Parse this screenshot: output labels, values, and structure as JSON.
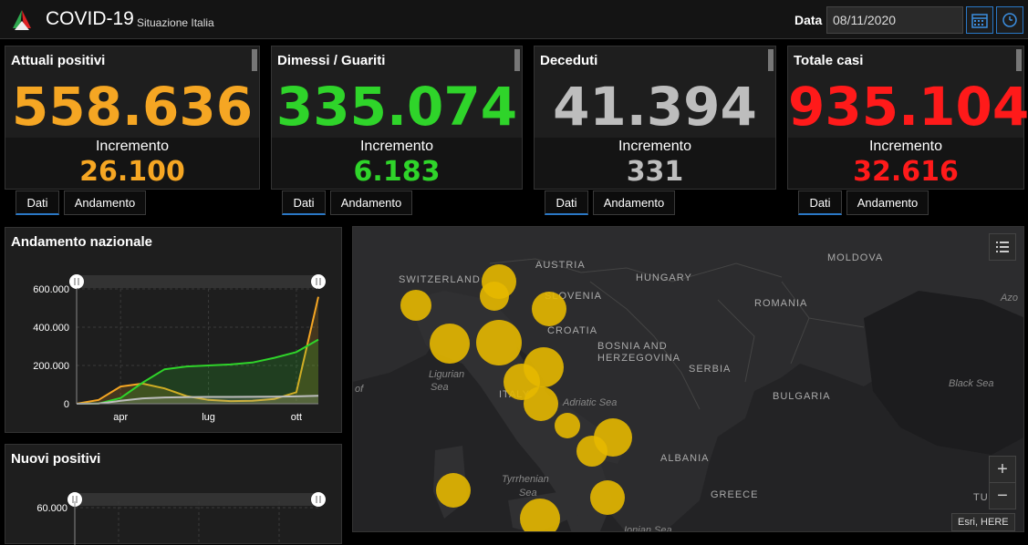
{
  "header": {
    "title": "COVID-19",
    "subtitle": "Situazione Italia",
    "date_label": "Data",
    "date_value": "08/11/2020"
  },
  "cards": [
    {
      "title": "Attuali positivi",
      "value": "558.636",
      "inc_label": "Incremento",
      "inc_value": "26.100",
      "color": "#f5a623"
    },
    {
      "title": "Dimessi / Guariti",
      "value": "335.074",
      "inc_label": "Incremento",
      "inc_value": "6.183",
      "color": "#2fd42a"
    },
    {
      "title": "Deceduti",
      "value": "41.394",
      "inc_label": "Incremento",
      "inc_value": "331",
      "color": "#bdbdbd"
    },
    {
      "title": "Totale casi",
      "value": "935.104",
      "inc_label": "Incremento",
      "inc_value": "32.616",
      "color": "#ff1a1a"
    }
  ],
  "tabs": {
    "dati": "Dati",
    "andamento": "Andamento"
  },
  "panels": {
    "andamento_title": "Andamento nazionale",
    "nuovi_title": "Nuovi positivi"
  },
  "chart_data": [
    {
      "type": "line",
      "title": "Andamento nazionale",
      "y_ticks": [
        "600.000",
        "400.000",
        "200.000",
        "0"
      ],
      "ylim": [
        0,
        600000
      ],
      "x_ticks": [
        "apr",
        "lug",
        "ott"
      ],
      "series": [
        {
          "color": "#f5a623",
          "values": [
            0,
            20000,
            90000,
            105000,
            80000,
            40000,
            20000,
            14000,
            15000,
            25000,
            60000,
            558636
          ]
        },
        {
          "color": "#2fd42a",
          "values": [
            0,
            1000,
            30000,
            110000,
            180000,
            195000,
            200000,
            205000,
            215000,
            240000,
            270000,
            335074
          ]
        },
        {
          "color": "#bdbdbd",
          "values": [
            0,
            1000,
            15000,
            28000,
            33000,
            35000,
            35500,
            35800,
            36000,
            37000,
            38500,
            41394
          ]
        }
      ]
    },
    {
      "type": "bar",
      "title": "Nuovi positivi",
      "y_ticks": [
        "60.000"
      ],
      "ylim": [
        0,
        60000
      ]
    }
  ],
  "map": {
    "labels": [
      {
        "text": "AUSTRIA",
        "kind": "country"
      },
      {
        "text": "SWITZERLAND",
        "kind": "country"
      },
      {
        "text": "HUNGARY",
        "kind": "country"
      },
      {
        "text": "MOLDOVA",
        "kind": "country"
      },
      {
        "text": "SLOVENIA",
        "kind": "country"
      },
      {
        "text": "ROMANIA",
        "kind": "country"
      },
      {
        "text": "CROATIA",
        "kind": "country"
      },
      {
        "text": "BOSNIA AND",
        "kind": "country"
      },
      {
        "text": "HERZEGOVINA",
        "kind": "country"
      },
      {
        "text": "SERBIA",
        "kind": "country"
      },
      {
        "text": "BULGARIA",
        "kind": "country"
      },
      {
        "text": "ALBANIA",
        "kind": "country"
      },
      {
        "text": "GREECE",
        "kind": "country"
      },
      {
        "text": "ITALY",
        "kind": "country"
      },
      {
        "text": "Ligurian",
        "kind": "sea"
      },
      {
        "text": "Sea",
        "kind": "sea"
      },
      {
        "text": "Adriatic Sea",
        "kind": "sea"
      },
      {
        "text": "Black Sea",
        "kind": "sea"
      },
      {
        "text": "Tyrrhenian",
        "kind": "sea"
      },
      {
        "text": "Sea",
        "kind": "sea"
      },
      {
        "text": "Ionian Sea",
        "kind": "sea"
      },
      {
        "text": "Azo",
        "kind": "sea"
      },
      {
        "text": "of",
        "kind": "sea"
      },
      {
        "text": "TU",
        "kind": "country"
      }
    ],
    "attribution": "Esri, HERE",
    "zoom_in": "+",
    "zoom_out": "−",
    "bubble_color": "#e6b800"
  }
}
